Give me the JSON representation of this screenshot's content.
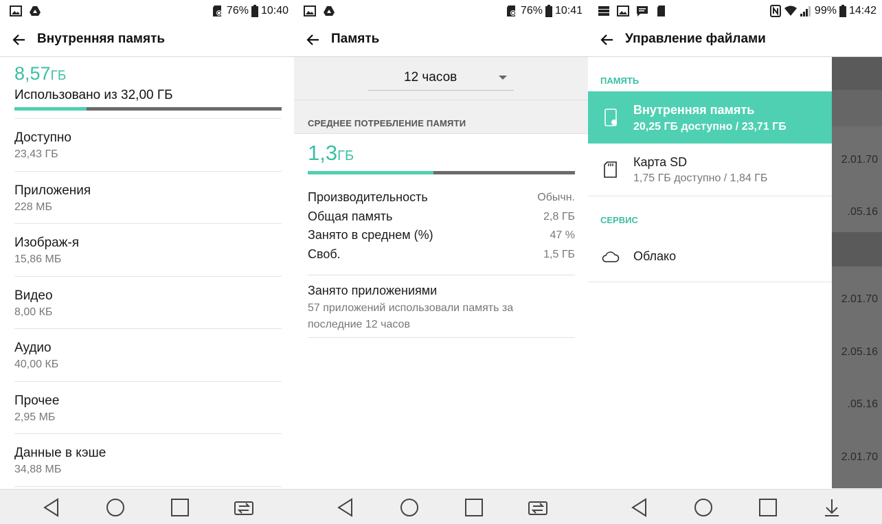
{
  "screens": [
    {
      "status": {
        "battery": "76%",
        "time": "10:40"
      },
      "title": "Внутренняя память",
      "used_value": "8,57",
      "used_unit": "ГБ",
      "used_of": "Использовано из 32,00 ГБ",
      "used_fraction": 0.27,
      "items": [
        {
          "label": "Доступно",
          "value": "23,43 ГБ"
        },
        {
          "label": "Приложения",
          "value": "228 МБ"
        },
        {
          "label": "Изображ-я",
          "value": "15,86 МБ"
        },
        {
          "label": "Видео",
          "value": "8,00 КБ"
        },
        {
          "label": "Аудио",
          "value": "40,00 КБ"
        },
        {
          "label": "Прочее",
          "value": "2,95 МБ"
        },
        {
          "label": "Данные в кэше",
          "value": "34,88 МБ"
        }
      ]
    },
    {
      "status": {
        "battery": "76%",
        "time": "10:41"
      },
      "title": "Память",
      "period": "12 часов",
      "section_header": "СРЕДНЕЕ ПОТРЕБЛЕНИЕ ПАМЯТИ",
      "avg_value": "1,3",
      "avg_unit": "ГБ",
      "avg_fraction": 0.47,
      "stats": [
        {
          "label": "Производительность",
          "value": "Обычн."
        },
        {
          "label": "Общая память",
          "value": "2,8 ГБ"
        },
        {
          "label": "Занято в среднем (%)",
          "value": "47 %"
        },
        {
          "label": "Своб.",
          "value": "1,5 ГБ"
        }
      ],
      "apps_title": "Занято приложениями",
      "apps_desc": "57 приложений использовали память за последние 12 часов"
    },
    {
      "status": {
        "battery": "99%",
        "time": "14:42"
      },
      "title": "Управление файлами",
      "memory_header": "ПАМЯТЬ",
      "storage": [
        {
          "title": "Внутренняя память",
          "detail": "20,25 ГБ доступно / 23,71 ГБ",
          "icon": "phone-storage-icon",
          "selected": true
        },
        {
          "title": "Карта SD",
          "detail": "1,75 ГБ доступно / 1,84 ГБ",
          "icon": "sd-card-icon",
          "selected": false
        }
      ],
      "service_header": "СЕРВИС",
      "cloud_label": "Облако",
      "background_dates": [
        "2.01.70",
        ".05.16",
        "2.01.70",
        "2.05.16",
        ".05.16",
        "2.01.70"
      ]
    }
  ],
  "colors": {
    "accent": "#4fd0b2",
    "accent_text": "#3cbfa4",
    "bar_track": "#6b6b6b"
  }
}
